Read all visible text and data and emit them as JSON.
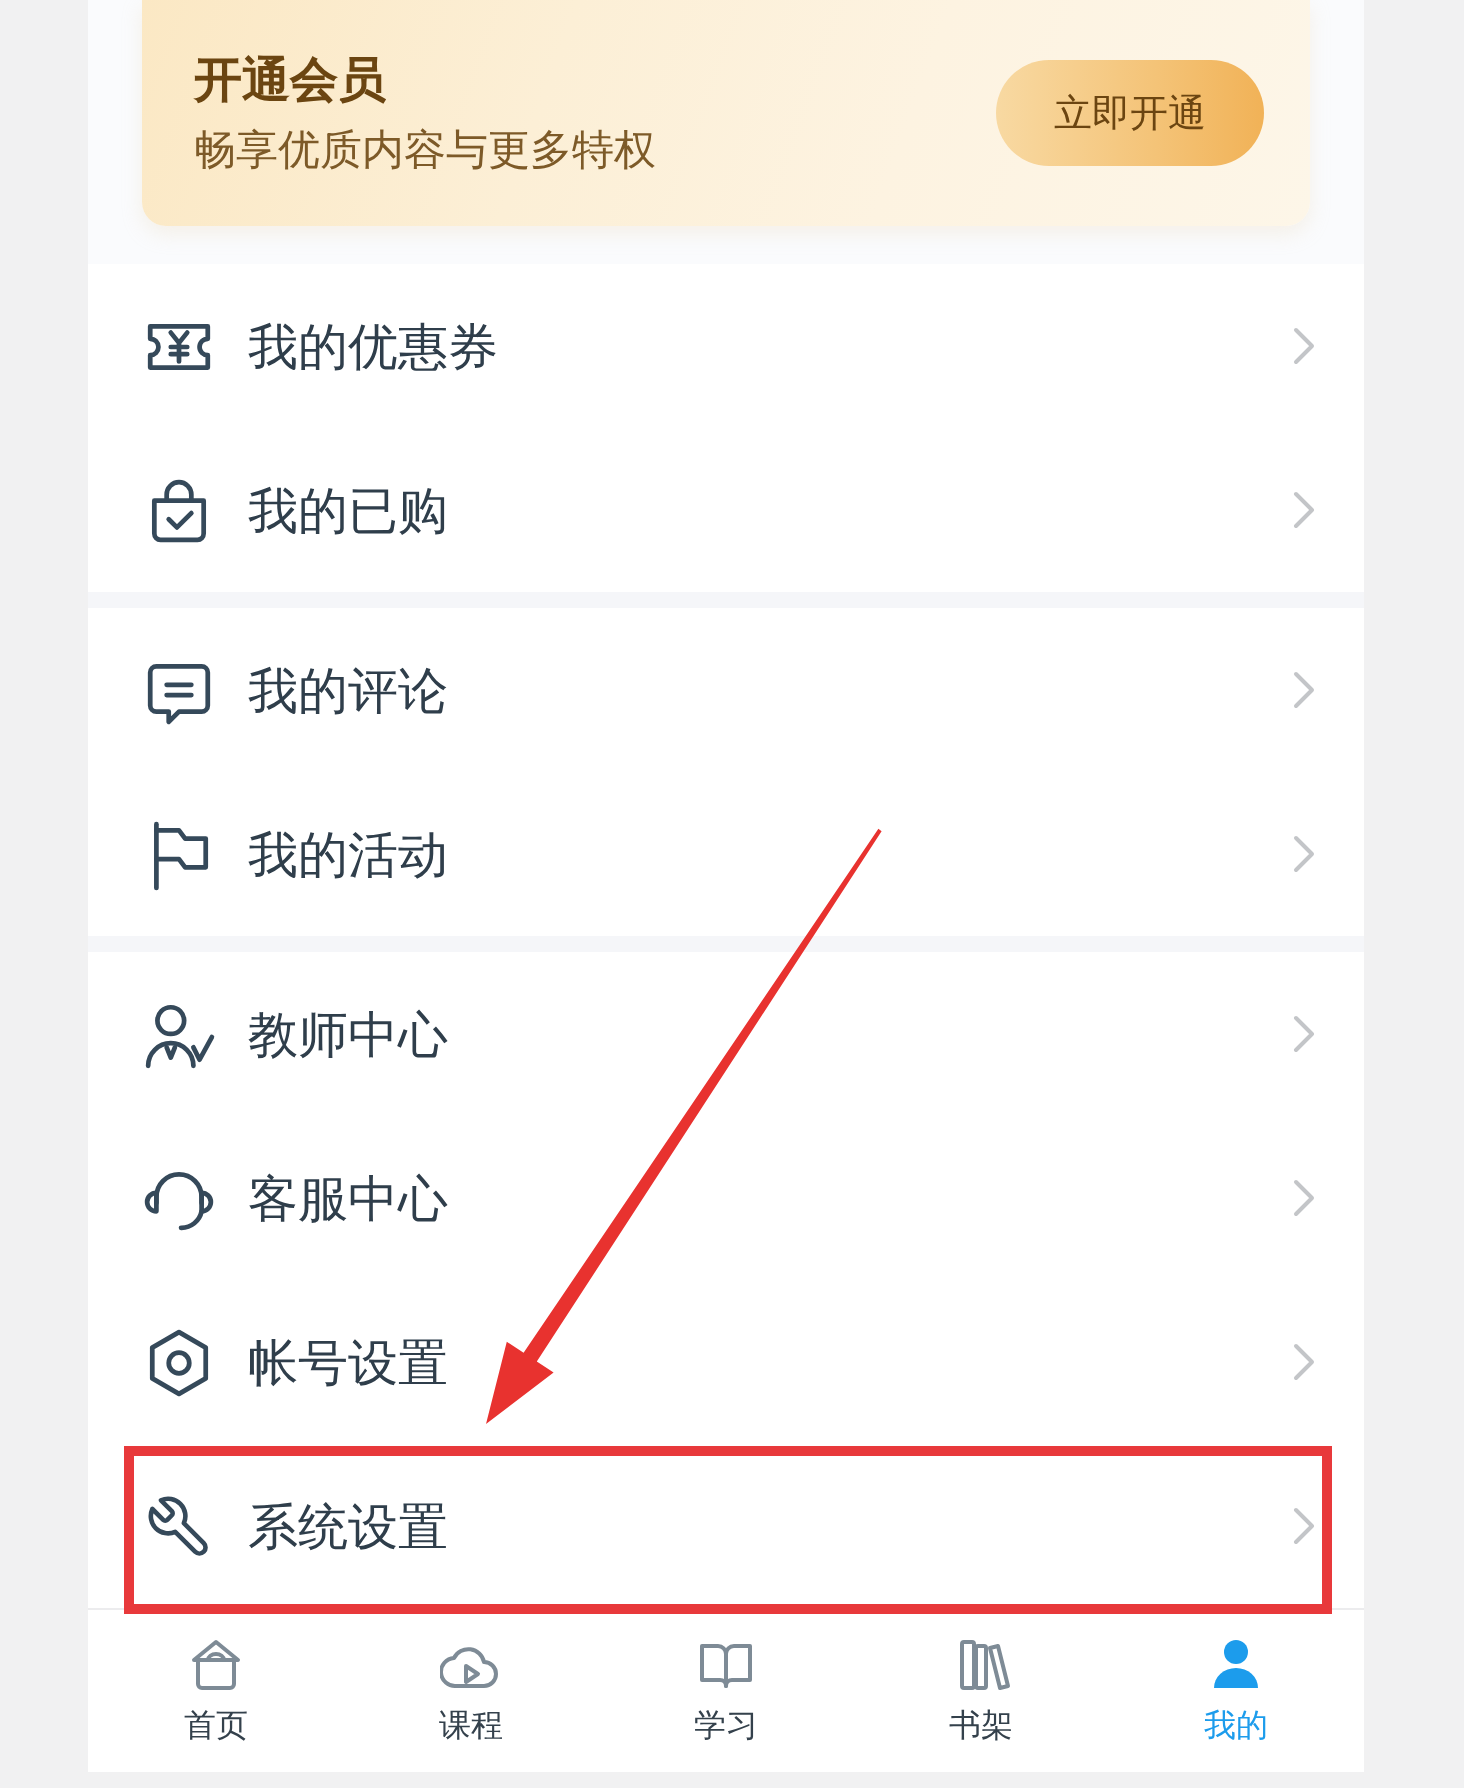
{
  "membership_banner": {
    "title": "开通会员",
    "subtitle": "畅享优质内容与更多特权",
    "button": "立即开通"
  },
  "menu_groups": [
    {
      "items": [
        {
          "label": "我的优惠券",
          "highlighted": false
        },
        {
          "label": "我的已购",
          "highlighted": false
        }
      ]
    },
    {
      "items": [
        {
          "label": "我的评论",
          "highlighted": false
        },
        {
          "label": "我的活动",
          "highlighted": false
        }
      ]
    },
    {
      "items": [
        {
          "label": "教师中心",
          "highlighted": false
        },
        {
          "label": "客服中心",
          "highlighted": false
        },
        {
          "label": "帐号设置",
          "highlighted": false
        },
        {
          "label": "系统设置",
          "highlighted": true
        }
      ]
    }
  ],
  "tab_bar": [
    {
      "label": "首页",
      "selected": false
    },
    {
      "label": "课程",
      "selected": false
    },
    {
      "label": "学习",
      "selected": false
    },
    {
      "label": "书架",
      "selected": false
    },
    {
      "label": "我的",
      "selected": true
    }
  ]
}
